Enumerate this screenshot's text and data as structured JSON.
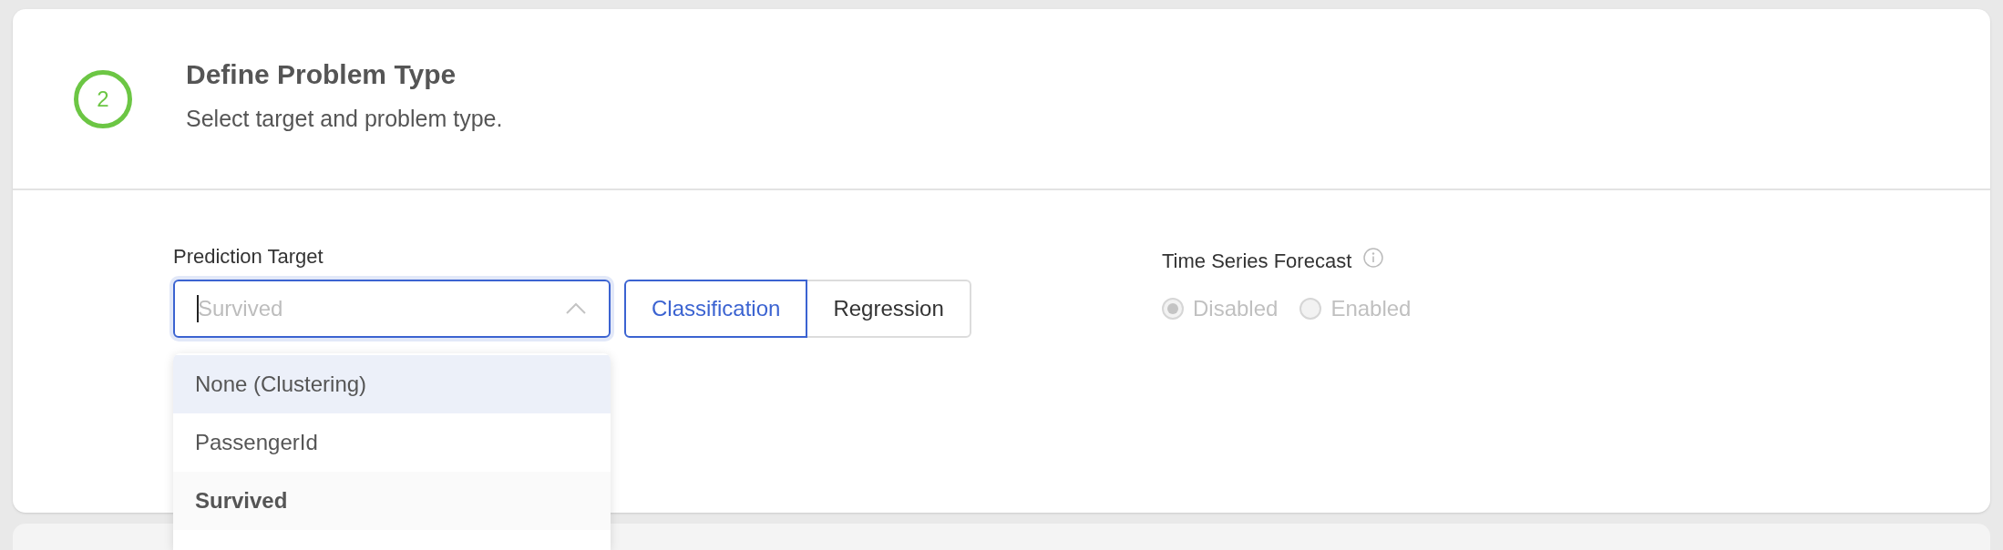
{
  "step": {
    "number": "2",
    "title": "Define Problem Type",
    "subtitle": "Select target and problem type."
  },
  "prediction_target": {
    "label": "Prediction Target",
    "placeholder": "Survived",
    "open": true,
    "options": [
      {
        "label": "None (Clustering)",
        "highlighted": true,
        "selected": false
      },
      {
        "label": "PassengerId",
        "highlighted": false,
        "selected": false
      },
      {
        "label": "Survived",
        "highlighted": false,
        "selected": true
      }
    ]
  },
  "problem_type": [
    {
      "label": "Classification",
      "selected": true
    },
    {
      "label": "Regression",
      "selected": false
    }
  ],
  "time_series": {
    "label": "Time Series Forecast",
    "options": [
      {
        "label": "Disabled",
        "selected": true,
        "disabled": true
      },
      {
        "label": "Enabled",
        "selected": false,
        "disabled": true
      }
    ]
  }
}
